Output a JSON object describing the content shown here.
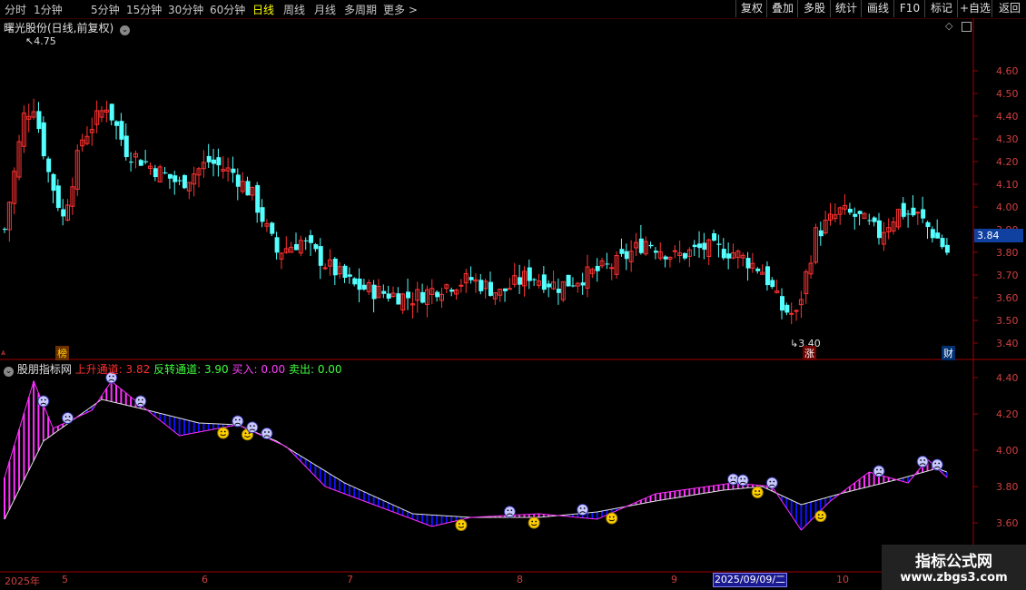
{
  "toolbar": {
    "periods": [
      "分时",
      "1分钟",
      "5分钟",
      "15分钟",
      "30分钟",
      "60分钟",
      "日线",
      "周线",
      "月线",
      "多周期",
      "更多 >"
    ],
    "active_period": "日线",
    "buttons": [
      "复权",
      "叠加",
      "多股",
      "统计",
      "画线",
      "F10",
      "标记",
      "+自选",
      "返回"
    ]
  },
  "main_chart": {
    "title": "曙光股份(日线,前复权)",
    "high_label": "4.75",
    "low_label": "3.40",
    "current_price": "3.84",
    "y_ticks": [
      "4.60",
      "4.50",
      "4.40",
      "4.30",
      "4.20",
      "4.10",
      "4.00",
      "3.90",
      "3.80",
      "3.70",
      "3.60",
      "3.50",
      "3.40"
    ],
    "badges": {
      "left": "榜",
      "mid": "涨",
      "right": "财"
    }
  },
  "indicator": {
    "name": "股朋指标网",
    "items": [
      {
        "label": "上升通道:",
        "value": "3.82",
        "color": "#ff3030"
      },
      {
        "label": "反转通道:",
        "value": "3.90",
        "color": "#40ff40"
      },
      {
        "label": "买入:",
        "value": "0.00",
        "color": "#ff40ff"
      },
      {
        "label": "卖出:",
        "value": "0.00",
        "color": "#40ff40"
      }
    ],
    "y_ticks": [
      "4.40",
      "4.20",
      "4.00",
      "3.80",
      "3.60"
    ]
  },
  "x_axis": {
    "labels": [
      "2025年",
      "5",
      "6",
      "7",
      "8",
      "9",
      "10"
    ],
    "highlight_date": "2025/09/09/二"
  },
  "watermark": {
    "line1": "指标公式网",
    "line2": "www.zbgs3.com"
  },
  "colors": {
    "up": "#ff3232",
    "down": "#54ffff",
    "bg": "#000000",
    "grid": "#800000",
    "magenta": "#ff30ff",
    "blue": "#1010ff"
  }
}
